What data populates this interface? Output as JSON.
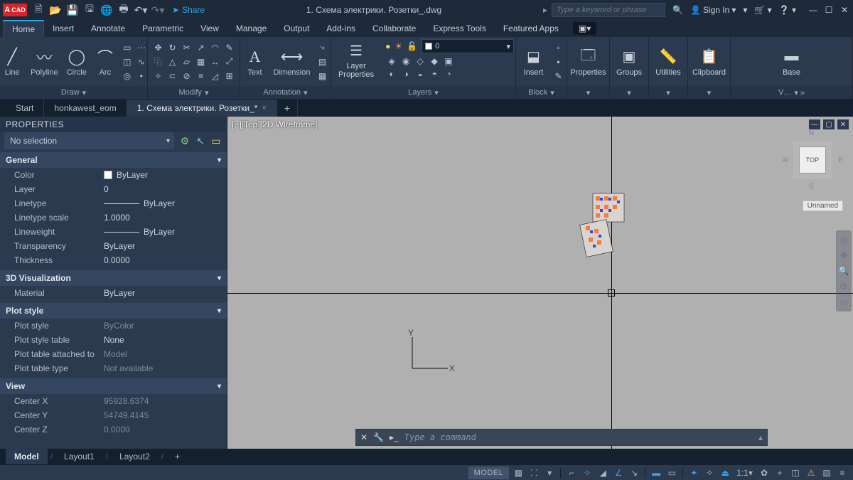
{
  "titlebar": {
    "share": "Share",
    "title": "1. Схема электрики. Розетки_.dwg",
    "search_placeholder": "Type a keyword or phrase",
    "sign_in": "Sign In"
  },
  "menu": [
    "Home",
    "Insert",
    "Annotate",
    "Parametric",
    "View",
    "Manage",
    "Output",
    "Add-ins",
    "Collaborate",
    "Express Tools",
    "Featured Apps"
  ],
  "ribbon": {
    "draw": {
      "title": "Draw",
      "line": "Line",
      "polyline": "Polyline",
      "circle": "Circle",
      "arc": "Arc"
    },
    "modify": {
      "title": "Modify"
    },
    "annotation": {
      "title": "Annotation",
      "text": "Text",
      "dimension": "Dimension"
    },
    "layers": {
      "title": "Layers",
      "props": "Layer\nProperties",
      "current": "0"
    },
    "block": {
      "title": "Block",
      "insert": "Insert"
    },
    "properties": "Properties",
    "groups": "Groups",
    "utilities": "Utilities",
    "clipboard": "Clipboard",
    "view": {
      "title": "V…",
      "base": "Base"
    }
  },
  "filetabs": {
    "start": "Start",
    "t1": "honkawest_eom",
    "t2": "1. Схема электрики. Розетки_*"
  },
  "properties": {
    "title": "PROPERTIES",
    "selection": "No selection",
    "sections": {
      "general": "General",
      "rows_general": [
        {
          "k": "Color",
          "v": "ByLayer",
          "swatch": true
        },
        {
          "k": "Layer",
          "v": "0"
        },
        {
          "k": "Linetype",
          "v": "ByLayer",
          "line": true
        },
        {
          "k": "Linetype scale",
          "v": "1.0000"
        },
        {
          "k": "Lineweight",
          "v": "ByLayer",
          "line": true
        },
        {
          "k": "Transparency",
          "v": "ByLayer"
        },
        {
          "k": "Thickness",
          "v": "0.0000"
        }
      ],
      "viz": "3D Visualization",
      "rows_viz": [
        {
          "k": "Material",
          "v": "ByLayer"
        }
      ],
      "plot": "Plot style",
      "rows_plot": [
        {
          "k": "Plot style",
          "v": "ByColor",
          "dim": true
        },
        {
          "k": "Plot style table",
          "v": "None"
        },
        {
          "k": "Plot table attached to",
          "v": "Model",
          "dim": true
        },
        {
          "k": "Plot table type",
          "v": "Not available",
          "dim": true
        }
      ],
      "view": "View",
      "rows_view": [
        {
          "k": "Center X",
          "v": "95928.6374",
          "dim": true
        },
        {
          "k": "Center Y",
          "v": "54749.4145",
          "dim": true
        },
        {
          "k": "Center Z",
          "v": "0.0000",
          "dim": true
        }
      ]
    }
  },
  "viewport": {
    "label": "[−][Top][2D Wireframe]",
    "cube": "TOP",
    "unnamed": "Unnamed",
    "ucs_x": "X",
    "ucs_y": "Y"
  },
  "cmdline": {
    "prompt": "Type a command"
  },
  "layouttabs": {
    "model": "Model",
    "l1": "Layout1",
    "l2": "Layout2"
  },
  "status": {
    "model": "MODEL",
    "scale": "1:1"
  }
}
